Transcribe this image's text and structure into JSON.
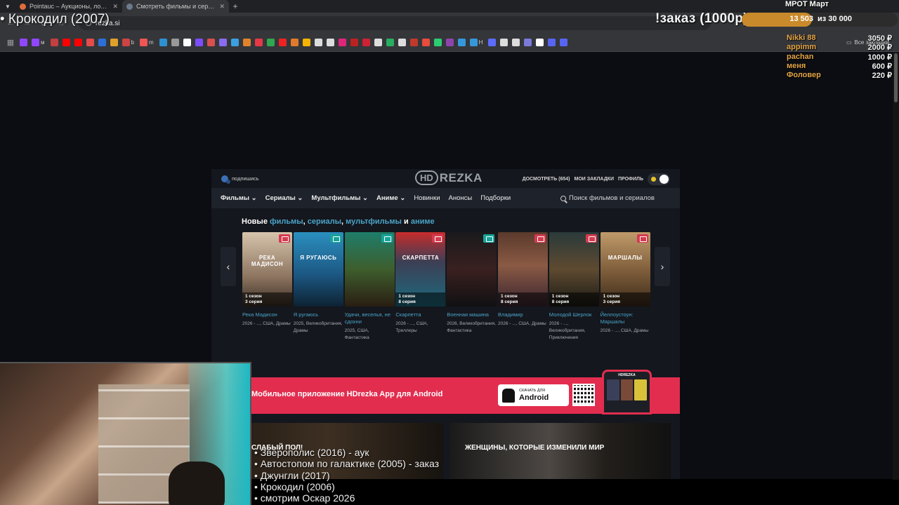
{
  "browser": {
    "tabs": [
      {
        "title": "Pointauc – Аукционы, лотереи",
        "fav": "#e06c3c"
      },
      {
        "title": "Смотреть фильмы и сериалы",
        "fav": "#6b7b8c"
      }
    ],
    "url": "rezka.si",
    "bookmarks_folder": "Все закладки",
    "bookmarks": [
      {
        "c": "#9146ff",
        "t": ""
      },
      {
        "c": "#9146ff",
        "t": "м"
      },
      {
        "c": "#c43f3f",
        "t": ""
      },
      {
        "c": "#ff0000",
        "t": ""
      },
      {
        "c": "#ff0000",
        "t": ""
      },
      {
        "c": "#e44b4b",
        "t": ""
      },
      {
        "c": "#2b6fd8",
        "t": ""
      },
      {
        "c": "#e0a12b",
        "t": ""
      },
      {
        "c": "#c44",
        "t": "b"
      },
      {
        "c": "#e55",
        "t": "m"
      },
      {
        "c": "#2f90d0",
        "t": ""
      },
      {
        "c": "#999",
        "t": ""
      },
      {
        "c": "#fff",
        "t": ""
      },
      {
        "c": "#7c4dff",
        "t": ""
      },
      {
        "c": "#d94f4f",
        "t": ""
      },
      {
        "c": "#8a6cf0",
        "t": ""
      },
      {
        "c": "#3aa0e0",
        "t": ""
      },
      {
        "c": "#e0832b",
        "t": ""
      },
      {
        "c": "#e63946",
        "t": ""
      },
      {
        "c": "#2fa84f",
        "t": ""
      },
      {
        "c": "#e22",
        "t": ""
      },
      {
        "c": "#e07a2b",
        "t": ""
      },
      {
        "c": "#f5b300",
        "t": ""
      },
      {
        "c": "#ddd",
        "t": ""
      },
      {
        "c": "#ddd",
        "t": ""
      },
      {
        "c": "#e0267a",
        "t": ""
      },
      {
        "c": "#b22",
        "t": ""
      },
      {
        "c": "#c23",
        "t": ""
      },
      {
        "c": "#ddd",
        "t": ""
      },
      {
        "c": "#27ae60",
        "t": ""
      },
      {
        "c": "#ddd",
        "t": ""
      },
      {
        "c": "#c0392b",
        "t": ""
      },
      {
        "c": "#e74c3c",
        "t": ""
      },
      {
        "c": "#2ecc71",
        "t": ""
      },
      {
        "c": "#8e44ad",
        "t": ""
      },
      {
        "c": "#3498db",
        "t": ""
      },
      {
        "c": "#3498db",
        "t": "Н"
      },
      {
        "c": "#5b6cff",
        "t": ""
      },
      {
        "c": "#ddd",
        "t": ""
      },
      {
        "c": "#ddd",
        "t": ""
      },
      {
        "c": "#7a7ad9",
        "t": ""
      },
      {
        "c": "#fff",
        "t": ""
      },
      {
        "c": "#5865f2",
        "t": ""
      },
      {
        "c": "#5865f2",
        "t": ""
      }
    ]
  },
  "overlay": {
    "now_playing": "• Крокодил (2007)",
    "order": "!заказ (1000р)",
    "goal_label": "МРОТ Март",
    "goal_current": "13 503",
    "goal_total": "из 30 000",
    "goal_fraction": 0.45,
    "donors": [
      {
        "name": "Nikki 88",
        "amount": "3050 ₽"
      },
      {
        "name": "appimm",
        "amount": "2000 ₽"
      },
      {
        "name": "pachan",
        "amount": "1000 ₽"
      },
      {
        "name": "меня",
        "amount": "600 ₽"
      },
      {
        "name": "Фоловер",
        "amount": "220 ₽"
      }
    ],
    "queue": [
      "• Зверополис (2016) - аук",
      "• Автостопом по галактике (2005) - заказ",
      "• Джунгли (2017)",
      "• Крокодил (2006)",
      "• смотрим Оскар 2026"
    ]
  },
  "site": {
    "subscribe": "подпишись",
    "logo_hd": "HD",
    "logo_rezka": "REZKA",
    "continue_watching": "ДОСМОТРЕТЬ (654)",
    "bookmarks": "МОИ ЗАКЛАДКИ",
    "profile": "ПРОФИЛЬ",
    "menu": {
      "films": "Фильмы ⌄",
      "series": "Сериалы ⌄",
      "cartoons": "Мультфильмы ⌄",
      "anime": "Аниме ⌄",
      "news": "Новинки",
      "announcements": "Анонсы",
      "collections": "Подборки"
    },
    "search_placeholder": "Поиск фильмов и сериалов",
    "new_heading": {
      "prefix": "Новые",
      "films": "фильмы",
      "series": "сериалы",
      "cartoons": "мультфильмы",
      "and": "и",
      "anime": "аниме"
    },
    "cards": [
      {
        "title": "Река Мадисон",
        "meta": "2026 - ..., США, Драмы",
        "season": "1 сезон",
        "episode": "3 серия",
        "poster_text": "РЕКА МАДИСОН",
        "badge": "red",
        "bg": "linear-gradient(180deg,#d7c4ad,#8d7560 60%,#3a2d24)"
      },
      {
        "title": "Я ругаюсь",
        "meta": "2025, Великобритания, Драмы",
        "season": "",
        "episode": "",
        "poster_text": "Я РУГАЮСЬ",
        "badge": "teal",
        "bg": "linear-gradient(180deg,#2a8fbe,#1d5a86 55%,#0d2233)"
      },
      {
        "title": "Удачи, веселья, не сдохни",
        "meta": "2025, США, Фантастика",
        "season": "",
        "episode": "",
        "poster_text": "",
        "badge": "teal",
        "bg": "linear-gradient(180deg,#1e7d6a,#3e5e2d 50%,#2a1d12)"
      },
      {
        "title": "Скарпетта",
        "meta": "2026 - ..., США, Триллеры",
        "season": "1 сезон",
        "episode": "8 серия",
        "poster_text": "СКАРПЕТТА",
        "badge": "red",
        "bg": "linear-gradient(180deg,#c72c2c,#3d3f55 40%,#1c6a7e)"
      },
      {
        "title": "Военная машина",
        "meta": "2026, Великобритания, Фантастика",
        "season": "",
        "episode": "",
        "poster_text": "",
        "badge": "teal",
        "bg": "linear-gradient(180deg,#1a1a1c,#3a2020 50%,#101012)"
      },
      {
        "title": "Владимир",
        "meta": "2026 - ..., США, Драмы",
        "season": "1 сезон",
        "episode": "8 серия",
        "poster_text": "",
        "badge": "red",
        "bg": "linear-gradient(180deg,#5a3a2c,#8a5a44 45%,#3a2430)"
      },
      {
        "title": "Молодой Шерлок",
        "meta": "2026 - ..., Великобритания, Приключения",
        "season": "1 сезон",
        "episode": "8 серия",
        "poster_text": "",
        "badge": "red",
        "bg": "linear-gradient(180deg,#2a3a3a,#5e4a30 50%,#1a1a14)"
      },
      {
        "title": "Йеллоустоун: Маршалы",
        "meta": "2026 - ..., США, Драмы",
        "season": "1 сезон",
        "episode": "3 серия",
        "poster_text": "МАРШАЛЫ",
        "badge": "red",
        "bg": "linear-gradient(180deg,#c09a6a,#7a5a38 55%,#3a2a1a)"
      }
    ],
    "banner_text": "Мобильное приложение HDrezka App для Android",
    "download_small": "СКАЧАТЬ ДЛЯ",
    "download_big": "Android",
    "phone_header": "HDREZKA",
    "collections": [
      {
        "title": "СЛАБЫЙ ПОЛ!"
      },
      {
        "title": "ЖЕНЩИНЫ, КОТОРЫЕ ИЗМЕНИЛИ МИР"
      }
    ]
  }
}
